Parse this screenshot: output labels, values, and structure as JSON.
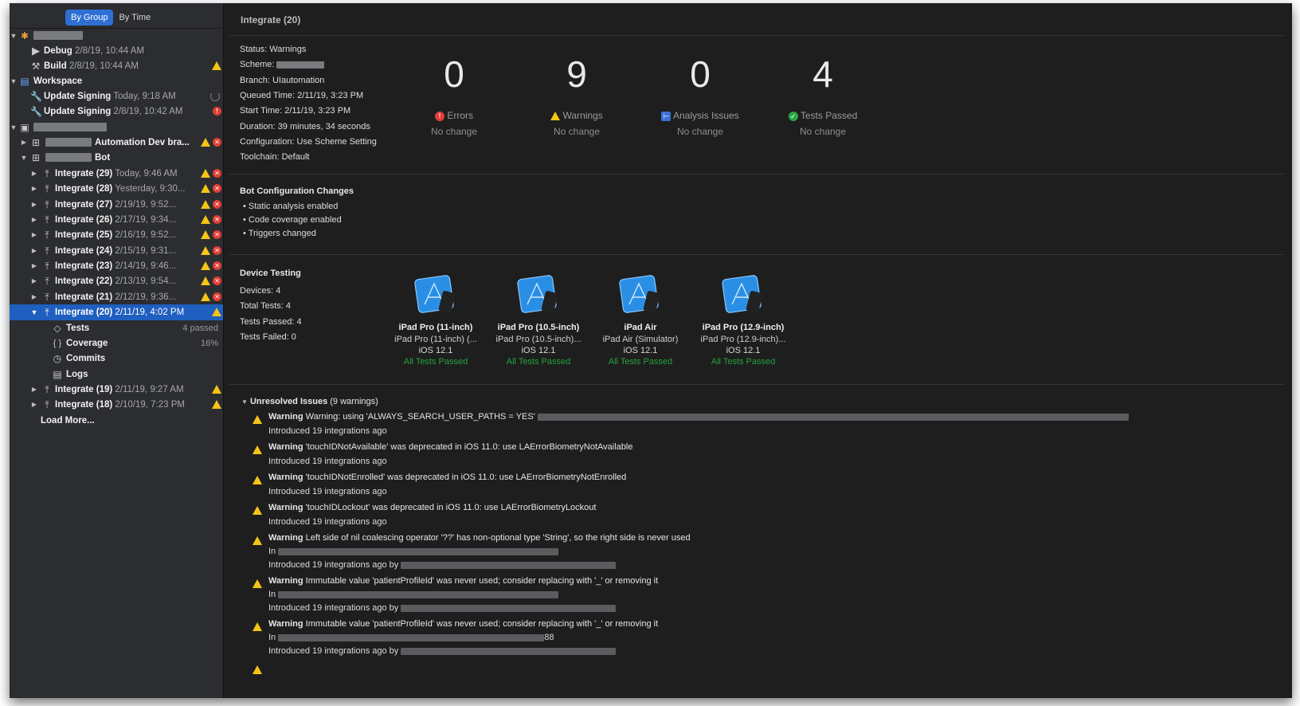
{
  "sidebar": {
    "segmented": [
      "By Group",
      "By Time"
    ],
    "rows": {
      "debug": {
        "name": "Debug",
        "time": "2/8/19, 10:44 AM"
      },
      "build": {
        "name": "Build",
        "time": "2/8/19, 10:44 AM"
      },
      "workspace": {
        "name": "Workspace"
      },
      "update1": {
        "name": "Update Signing",
        "time": "Today, 9:18 AM"
      },
      "update2": {
        "name": "Update Signing",
        "time": "2/8/19, 10:42 AM"
      },
      "automation": {
        "name": "Automation Dev bra..."
      },
      "bot": {
        "name": "Bot"
      }
    },
    "integrations": [
      {
        "name": "Integrate (29)",
        "time": "Today, 9:46 AM"
      },
      {
        "name": "Integrate (28)",
        "time": "Yesterday, 9:30..."
      },
      {
        "name": "Integrate (27)",
        "time": "2/19/19, 9:52..."
      },
      {
        "name": "Integrate (26)",
        "time": "2/17/19, 9:34..."
      },
      {
        "name": "Integrate (25)",
        "time": "2/16/19, 9:52..."
      },
      {
        "name": "Integrate (24)",
        "time": "2/15/19, 9:31..."
      },
      {
        "name": "Integrate (23)",
        "time": "2/14/19, 9:46..."
      },
      {
        "name": "Integrate (22)",
        "time": "2/13/19, 9:54..."
      },
      {
        "name": "Integrate (21)",
        "time": "2/12/19, 9:36..."
      }
    ],
    "selected": {
      "name": "Integrate (20)",
      "time": "2/11/19, 4:02 PM"
    },
    "children": {
      "tests": {
        "label": "Tests",
        "value": "4 passed"
      },
      "coverage": {
        "label": "Coverage",
        "value": "16%"
      },
      "commits": {
        "label": "Commits"
      },
      "logs": {
        "label": "Logs"
      }
    },
    "after": [
      {
        "name": "Integrate (19)",
        "time": "2/11/19, 9:27 AM"
      },
      {
        "name": "Integrate (18)",
        "time": "2/10/19, 7:23 PM"
      }
    ],
    "load_more": "Load More..."
  },
  "main": {
    "title": "Integrate (20)",
    "info": [
      "Status: Warnings",
      "Scheme:",
      "Branch: UIautomation",
      "Queued Time: 2/11/19, 3:23 PM",
      "Start Time: 2/11/19, 3:23 PM",
      "Duration: 39 minutes, 34 seconds",
      "Configuration: Use Scheme Setting",
      "Toolchain: Default"
    ],
    "metrics": [
      {
        "value": "0",
        "label": "Errors",
        "sub": "No change",
        "icon": "error-icon"
      },
      {
        "value": "9",
        "label": "Warnings",
        "sub": "No change",
        "icon": "warning-icon"
      },
      {
        "value": "0",
        "label": "Analysis Issues",
        "sub": "No change",
        "icon": "analysis-icon"
      },
      {
        "value": "4",
        "label": "Tests Passed",
        "sub": "No change",
        "icon": "check-icon"
      }
    ],
    "bot_config": {
      "title": "Bot Configuration Changes",
      "items": [
        "• Static analysis enabled",
        "• Code coverage enabled",
        "• Triggers changed"
      ]
    },
    "device_testing": {
      "title": "Device Testing",
      "stats": [
        "Devices: 4",
        "Total Tests: 4",
        "Tests Passed: 4",
        "Tests Failed: 0"
      ],
      "devices": [
        {
          "name": "iPad Pro (11-inch)",
          "model": "iPad Pro (11-inch) (...",
          "os": "iOS 12.1",
          "status": "All Tests Passed"
        },
        {
          "name": "iPad Pro (10.5-inch)",
          "model": "iPad Pro (10.5-inch)...",
          "os": "iOS 12.1",
          "status": "All Tests Passed"
        },
        {
          "name": "iPad Air",
          "model": "iPad Air (Simulator)",
          "os": "iOS 12.1",
          "status": "All Tests Passed"
        },
        {
          "name": "iPad Pro (12.9-inch)",
          "model": "iPad Pro (12.9-inch)...",
          "os": "iOS 12.1",
          "status": "All Tests Passed"
        }
      ]
    },
    "issues": {
      "title": "Unresolved Issues",
      "count": "(9 warnings)",
      "list": [
        {
          "kind": "Warning",
          "text": "Warning: using 'ALWAYS_SEARCH_USER_PATHS = YES'",
          "introduced": "Introduced 19 integrations ago"
        },
        {
          "kind": "Warning",
          "text": "'touchIDNotAvailable' was deprecated in iOS 11.0: use LAErrorBiometryNotAvailable",
          "introduced": "Introduced 19 integrations ago"
        },
        {
          "kind": "Warning",
          "text": "'touchIDNotEnrolled' was deprecated in iOS 11.0: use LAErrorBiometryNotEnrolled",
          "introduced": "Introduced 19 integrations ago"
        },
        {
          "kind": "Warning",
          "text": "'touchIDLockout' was deprecated in iOS 11.0: use LAErrorBiometryLockout",
          "introduced": "Introduced 19 integrations ago"
        },
        {
          "kind": "Warning",
          "text": "Left side of nil coalescing operator '??' has non-optional type 'String', so the right side is never used",
          "in": "In",
          "introduced": "Introduced 19 integrations ago by"
        },
        {
          "kind": "Warning",
          "text": "Immutable value 'patientProfileId' was never used; consider replacing with '_' or removing it",
          "in": "In",
          "introduced": "Introduced 19 integrations ago by"
        },
        {
          "kind": "Warning",
          "text": "Immutable value 'patientProfileId' was never used; consider replacing with '_' or removing it",
          "in": "In",
          "in_suffix": "88",
          "introduced": "Introduced 19 integrations ago by"
        }
      ]
    }
  },
  "colors": {
    "accent": "#2f6fd3",
    "warning": "#f6c416",
    "error": "#e33d37",
    "success": "#24a33a"
  }
}
